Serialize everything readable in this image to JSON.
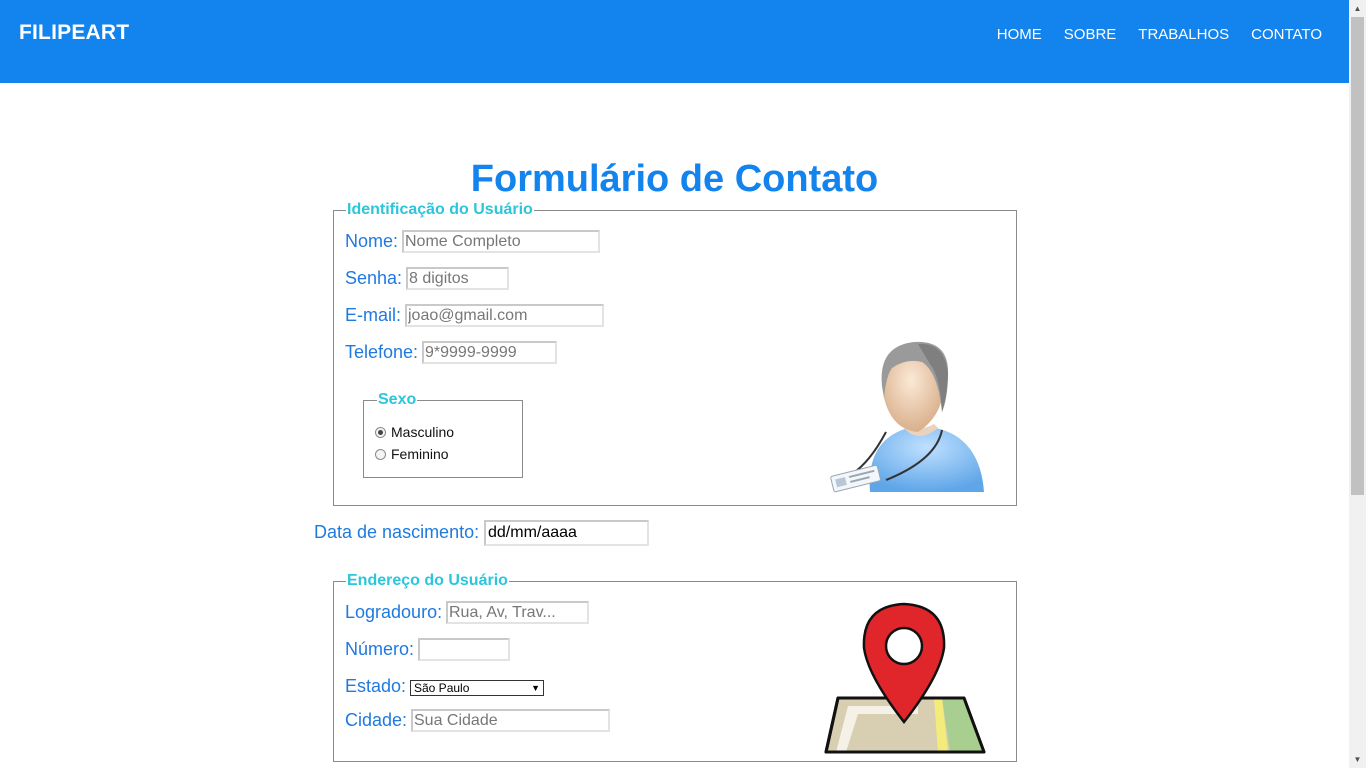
{
  "nav": {
    "brand": "FILIPEART",
    "links": [
      "HOME",
      "SOBRE",
      "TRABALHOS",
      "CONTATO"
    ]
  },
  "page": {
    "title": "Formulário de Contato"
  },
  "identificacao": {
    "legend": "Identificação do Usuário",
    "nome": {
      "label": "Nome:",
      "placeholder": "Nome Completo"
    },
    "senha": {
      "label": "Senha:",
      "placeholder": "8 digitos"
    },
    "email": {
      "label": "E-mail:",
      "placeholder": "joao@gmail.com"
    },
    "telefone": {
      "label": "Telefone:",
      "placeholder": "9*9999-9999"
    },
    "sexo": {
      "legend": "Sexo",
      "options": [
        "Masculino",
        "Feminino"
      ],
      "selected": "Masculino"
    },
    "illustration_icon": "user-badge-icon"
  },
  "nascimento": {
    "label": "Data de nascimento:",
    "value": "dd/mm/aaaa"
  },
  "endereco": {
    "legend": "Endereço do Usuário",
    "logradouro": {
      "label": "Logradouro:",
      "placeholder": "Rua, Av, Trav..."
    },
    "numero": {
      "label": "Número:",
      "value": ""
    },
    "estado": {
      "label": "Estado:",
      "selected": "São Paulo"
    },
    "cidade": {
      "label": "Cidade:",
      "placeholder": "Sua Cidade"
    },
    "illustration_icon": "map-pin-icon"
  },
  "colors": {
    "primary": "#1383ee",
    "label": "#1f7ae0",
    "legend": "#2bc6d9",
    "pin": "#e0262b"
  }
}
